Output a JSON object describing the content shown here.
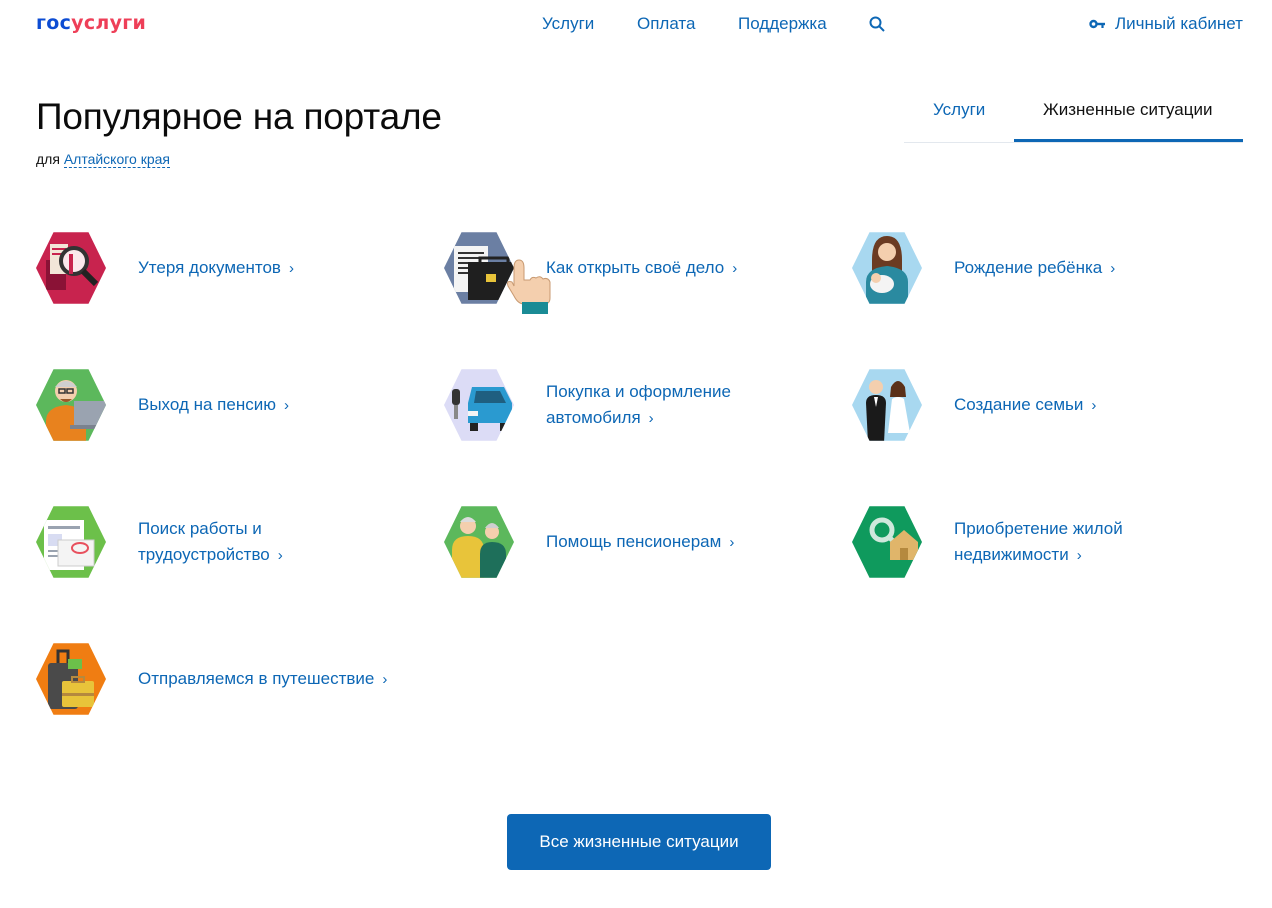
{
  "header": {
    "logo_part1": "гос",
    "logo_part2": "услуги",
    "nav": [
      "Услуги",
      "Оплата",
      "Поддержка"
    ],
    "cabinet": "Личный кабинет"
  },
  "title": "Популярное на портале",
  "subtitle_prefix": "для",
  "region": "Алтайского края",
  "tabs": [
    {
      "label": "Услуги",
      "active": false
    },
    {
      "label": "Жизненные ситуации",
      "active": true
    }
  ],
  "situations": [
    {
      "line1": "Утеря документов",
      "line2": "",
      "icon": "lost-documents-icon",
      "color": "#c8234e"
    },
    {
      "line1": "Как открыть своё дело",
      "line2": "",
      "icon": "briefcase-icon",
      "color": "#6b7fa3"
    },
    {
      "line1": "Рождение ребёнка",
      "line2": "",
      "icon": "mother-baby-icon",
      "color": "#a8d8f0"
    },
    {
      "line1": "Выход на пенсию",
      "line2": "",
      "icon": "pensioner-icon",
      "color": "#5cb85c"
    },
    {
      "line1": "Покупка и оформление",
      "line2": "автомобиля",
      "icon": "car-icon",
      "color": "#dcdcf6"
    },
    {
      "line1": "Создание семьи",
      "line2": "",
      "icon": "wedding-icon",
      "color": "#a8d8f0"
    },
    {
      "line1": "Поиск работы и",
      "line2": "трудоустройство",
      "icon": "resume-icon",
      "color": "#6cc04a"
    },
    {
      "line1": "Помощь пенсионерам",
      "line2": "",
      "icon": "elderly-couple-icon",
      "color": "#5cb85c"
    },
    {
      "line1": "Приобретение жилой",
      "line2": "недвижимости",
      "icon": "house-key-icon",
      "color": "#0f9a5d"
    },
    {
      "line1": "Отправляемся в путешествие",
      "line2": "",
      "icon": "luggage-icon",
      "color": "#f07d12"
    }
  ],
  "button": "Все жизненные ситуации"
}
